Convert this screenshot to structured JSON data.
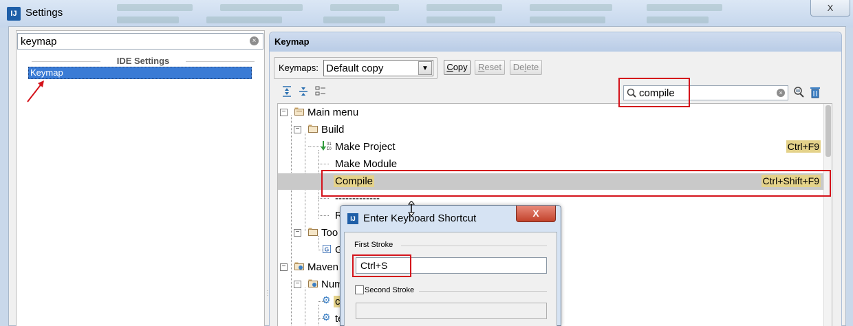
{
  "window": {
    "title": "Settings",
    "logo_text": "IJ",
    "close_glyph": "X"
  },
  "left": {
    "search_value": "keymap",
    "group_title": "IDE Settings",
    "selected_item": "Keymap"
  },
  "right": {
    "header": "Keymap",
    "keymaps_label": "Keymaps:",
    "keymap_selected": "Default copy",
    "buttons": {
      "copy": {
        "pre": "",
        "u": "C",
        "post": "opy"
      },
      "reset": {
        "pre": "",
        "u": "R",
        "post": "eset"
      },
      "delete": {
        "pre": "De",
        "u": "l",
        "post": "ete"
      }
    },
    "filter_value": "compile"
  },
  "tree": {
    "rows": [
      {
        "label": "Main menu",
        "shortcut": ""
      },
      {
        "label": "Build",
        "shortcut": ""
      },
      {
        "label": "Make Project",
        "shortcut": "Ctrl+F9"
      },
      {
        "label": "Make Module",
        "shortcut": ""
      },
      {
        "label": "Compile",
        "shortcut": "Ctrl+Shift+F9"
      },
      {
        "label": "-------------",
        "shortcut": ""
      },
      {
        "label": "R",
        "shortcut": ""
      },
      {
        "label": "Too",
        "shortcut": ""
      },
      {
        "label": "G",
        "shortcut": ""
      },
      {
        "label": "Maven",
        "shortcut": ""
      },
      {
        "label": "Num",
        "shortcut": ""
      },
      {
        "label": "cl",
        "shortcut": ""
      },
      {
        "label": "te",
        "shortcut": ""
      }
    ]
  },
  "dialog": {
    "title": "Enter Keyboard Shortcut",
    "first_stroke_label": "First Stroke",
    "first_stroke_value": "Ctrl+S",
    "second_stroke_label": "Second Stroke",
    "close_glyph": "X"
  },
  "colors": {
    "accent": "#3a7bd5",
    "annotation_red": "#d4131b",
    "match_highlight": "#e4d28a",
    "header_blue": "#c5d6ec"
  }
}
